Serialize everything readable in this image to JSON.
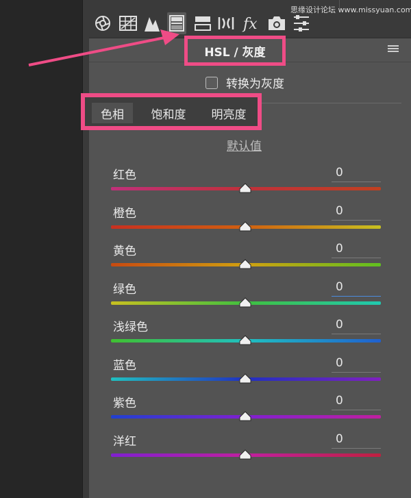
{
  "watermark": "思缘设计论坛 www.missyuan.com",
  "panel": {
    "title": "HSL / 灰度",
    "convert_grayscale_label": "转换为灰度",
    "tabs": [
      {
        "label": "色相",
        "active": true
      },
      {
        "label": "饱和度",
        "active": false
      },
      {
        "label": "明亮度",
        "active": false
      }
    ],
    "default_link": "默认值"
  },
  "sliders": [
    {
      "label": "红色",
      "value": "0",
      "gradient": [
        "#c0307a",
        "#c0303a",
        "#c04020"
      ]
    },
    {
      "label": "橙色",
      "value": "0",
      "gradient": [
        "#c83020",
        "#d06010",
        "#c8c020"
      ]
    },
    {
      "label": "黄色",
      "value": "0",
      "gradient": [
        "#c84a10",
        "#d0a010",
        "#60c020"
      ]
    },
    {
      "label": "绿色",
      "value": "0",
      "gradient": [
        "#c8c020",
        "#40c040",
        "#20c8b0"
      ]
    },
    {
      "label": "浅绿色",
      "value": "0",
      "gradient": [
        "#40c030",
        "#20c0c0",
        "#2060d0"
      ]
    },
    {
      "label": "蓝色",
      "value": "0",
      "gradient": [
        "#20c0c0",
        "#2030c0",
        "#8020c0"
      ]
    },
    {
      "label": "紫色",
      "value": "0",
      "gradient": [
        "#2040d0",
        "#8020d0",
        "#c020a0"
      ]
    },
    {
      "label": "洋红",
      "value": "0",
      "gradient": [
        "#8020d0",
        "#c020a0",
        "#c02040"
      ]
    }
  ],
  "colors": {
    "highlight": "#ef4c86",
    "panel_bg": "#535353",
    "focus_underline": "#4a8de0"
  }
}
